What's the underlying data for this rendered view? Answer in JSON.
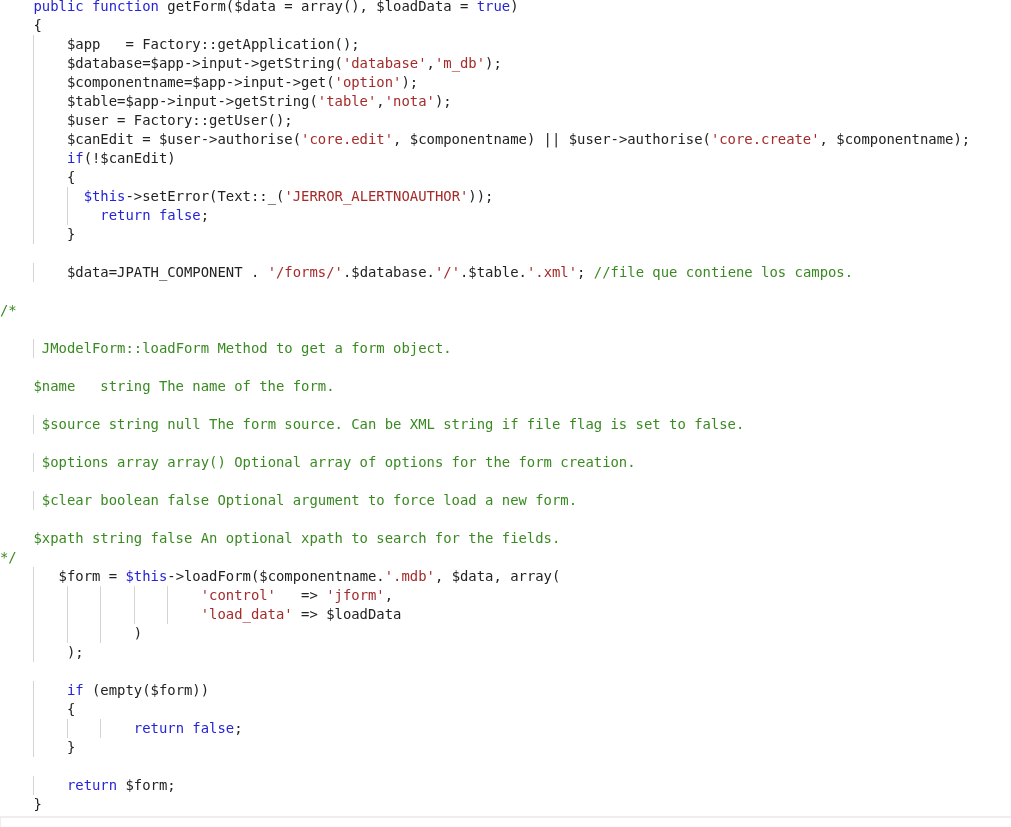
{
  "editor": {
    "lines": [
      {
        "kind": "code",
        "segments": [
          {
            "kind": "keyword",
            "text": "    public function"
          },
          {
            "kind": "plain",
            "text": " getForm($data = array(), $loadData = "
          },
          {
            "kind": "keyword",
            "text": "true"
          },
          {
            "kind": "plain",
            "text": ")"
          }
        ]
      },
      {
        "kind": "code",
        "segments": [
          {
            "kind": "plain",
            "text": "    {"
          }
        ]
      },
      {
        "kind": "code",
        "segments": [
          {
            "kind": "plain",
            "text": "        $app   = Factory::getApplication();"
          }
        ]
      },
      {
        "kind": "code",
        "segments": [
          {
            "kind": "plain",
            "text": "        $database=$app->input->getString("
          },
          {
            "kind": "string",
            "text": "'database'"
          },
          {
            "kind": "plain",
            "text": ","
          },
          {
            "kind": "string",
            "text": "'m_db'"
          },
          {
            "kind": "plain",
            "text": ");"
          }
        ]
      },
      {
        "kind": "code",
        "segments": [
          {
            "kind": "plain",
            "text": "        $componentname=$app->input->get("
          },
          {
            "kind": "string",
            "text": "'option'"
          },
          {
            "kind": "plain",
            "text": ");"
          }
        ]
      },
      {
        "kind": "code",
        "segments": [
          {
            "kind": "plain",
            "text": "        $table=$app->input->getString("
          },
          {
            "kind": "string",
            "text": "'table'"
          },
          {
            "kind": "plain",
            "text": ","
          },
          {
            "kind": "string",
            "text": "'nota'"
          },
          {
            "kind": "plain",
            "text": ");"
          }
        ]
      },
      {
        "kind": "code",
        "segments": [
          {
            "kind": "plain",
            "text": "        $user = Factory::getUser();"
          }
        ]
      },
      {
        "kind": "code",
        "segments": [
          {
            "kind": "plain",
            "text": "        $canEdit = $user->authorise("
          },
          {
            "kind": "string",
            "text": "'core.edit'"
          },
          {
            "kind": "plain",
            "text": ", $componentname) || $user->authorise("
          },
          {
            "kind": "string",
            "text": "'core.create'"
          },
          {
            "kind": "plain",
            "text": ", $componentname);"
          }
        ]
      },
      {
        "kind": "code",
        "segments": [
          {
            "kind": "keyword",
            "text": "        if"
          },
          {
            "kind": "plain",
            "text": "(!$canEdit)"
          }
        ]
      },
      {
        "kind": "code",
        "segments": [
          {
            "kind": "plain",
            "text": "        {"
          }
        ]
      },
      {
        "kind": "code",
        "segments": [
          {
            "kind": "keyword",
            "text": "          $this"
          },
          {
            "kind": "plain",
            "text": "->setError(Text::_("
          },
          {
            "kind": "string",
            "text": "'JERROR_ALERTNOAUTHOR'"
          },
          {
            "kind": "plain",
            "text": "));"
          }
        ]
      },
      {
        "kind": "code",
        "segments": [
          {
            "kind": "keyword",
            "text": "            return false"
          },
          {
            "kind": "plain",
            "text": ";"
          }
        ]
      },
      {
        "kind": "code",
        "segments": [
          {
            "kind": "plain",
            "text": "        }"
          }
        ]
      },
      {
        "kind": "blank"
      },
      {
        "kind": "code",
        "segments": [
          {
            "kind": "plain",
            "text": "        $data=JPATH_COMPONENT . "
          },
          {
            "kind": "string",
            "text": "'/forms/'"
          },
          {
            "kind": "plain",
            "text": ".$database."
          },
          {
            "kind": "string",
            "text": "'/'"
          },
          {
            "kind": "plain",
            "text": ".$table."
          },
          {
            "kind": "string",
            "text": "'.xml'"
          },
          {
            "kind": "plain",
            "text": "; "
          },
          {
            "kind": "comment",
            "text": "//file que contiene los campos."
          }
        ]
      },
      {
        "kind": "blank"
      },
      {
        "kind": "code",
        "segments": [
          {
            "kind": "comment",
            "text": "/*"
          }
        ]
      },
      {
        "kind": "blank"
      },
      {
        "kind": "code",
        "segments": [
          {
            "kind": "comment",
            "text": "     JModelForm::loadForm Method to get a form object."
          }
        ]
      },
      {
        "kind": "blank"
      },
      {
        "kind": "code",
        "segments": [
          {
            "kind": "comment",
            "text": "    $name   string The name of the form."
          }
        ]
      },
      {
        "kind": "blank"
      },
      {
        "kind": "code",
        "segments": [
          {
            "kind": "comment",
            "text": "     $source string null The form source. Can be XML string if file flag is set to false."
          }
        ]
      },
      {
        "kind": "blank"
      },
      {
        "kind": "code",
        "segments": [
          {
            "kind": "comment",
            "text": "     $options array array() Optional array of options for the form creation."
          }
        ]
      },
      {
        "kind": "blank"
      },
      {
        "kind": "code",
        "segments": [
          {
            "kind": "comment",
            "text": "     $clear boolean false Optional argument to force load a new form."
          }
        ]
      },
      {
        "kind": "blank"
      },
      {
        "kind": "code",
        "segments": [
          {
            "kind": "comment",
            "text": "    $xpath string false An optional xpath to search for the fields."
          }
        ]
      },
      {
        "kind": "code",
        "segments": [
          {
            "kind": "comment",
            "text": "*/"
          }
        ]
      },
      {
        "kind": "code",
        "segments": [
          {
            "kind": "plain",
            "text": "       $form = "
          },
          {
            "kind": "keyword",
            "text": "$this"
          },
          {
            "kind": "plain",
            "text": "->loadForm($componentname."
          },
          {
            "kind": "string",
            "text": "'.mdb'"
          },
          {
            "kind": "plain",
            "text": ", $data, array("
          }
        ]
      },
      {
        "kind": "code",
        "segments": [
          {
            "kind": "string",
            "text": "                        'control'"
          },
          {
            "kind": "plain",
            "text": "   => "
          },
          {
            "kind": "string",
            "text": "'jform'"
          },
          {
            "kind": "plain",
            "text": ","
          }
        ]
      },
      {
        "kind": "code",
        "segments": [
          {
            "kind": "string",
            "text": "                        'load_data'"
          },
          {
            "kind": "plain",
            "text": " => $loadData"
          }
        ]
      },
      {
        "kind": "code",
        "segments": [
          {
            "kind": "plain",
            "text": "                )"
          }
        ]
      },
      {
        "kind": "code",
        "segments": [
          {
            "kind": "plain",
            "text": "        );"
          }
        ]
      },
      {
        "kind": "blank"
      },
      {
        "kind": "code",
        "segments": [
          {
            "kind": "keyword",
            "text": "        if"
          },
          {
            "kind": "plain",
            "text": " (empty($form))"
          }
        ]
      },
      {
        "kind": "code",
        "segments": [
          {
            "kind": "plain",
            "text": "        {"
          }
        ]
      },
      {
        "kind": "code",
        "segments": [
          {
            "kind": "keyword",
            "text": "                return false"
          },
          {
            "kind": "plain",
            "text": ";"
          }
        ]
      },
      {
        "kind": "code",
        "segments": [
          {
            "kind": "plain",
            "text": "        }"
          }
        ]
      },
      {
        "kind": "blank"
      },
      {
        "kind": "code",
        "segments": [
          {
            "kind": "keyword",
            "text": "        return"
          },
          {
            "kind": "plain",
            "text": " $form;"
          }
        ]
      },
      {
        "kind": "code",
        "segments": [
          {
            "kind": "plain",
            "text": "    }"
          }
        ]
      }
    ]
  }
}
